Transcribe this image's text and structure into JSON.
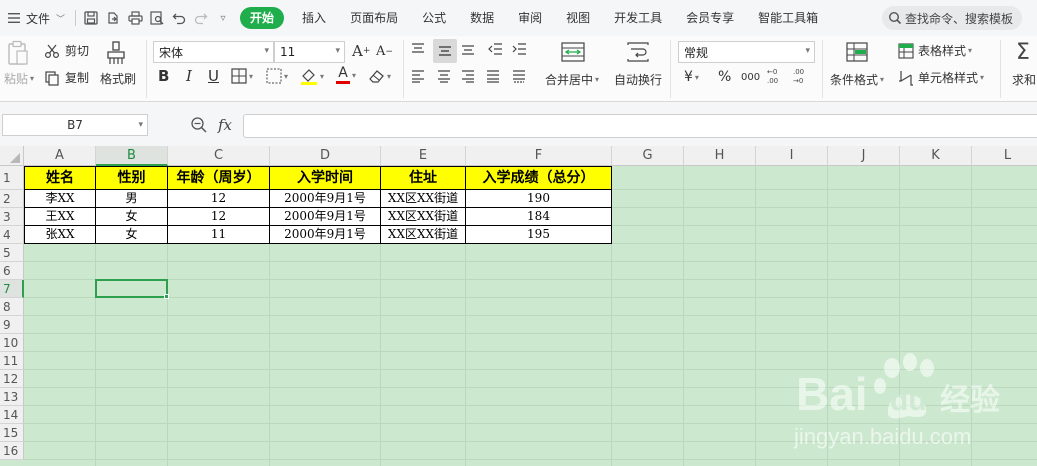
{
  "menubar": {
    "file_label": "文件",
    "tabs": [
      "开始",
      "插入",
      "页面布局",
      "公式",
      "数据",
      "审阅",
      "视图",
      "开发工具",
      "会员专享",
      "智能工具箱"
    ],
    "active_tab": "开始",
    "search_placeholder": "查找命令、搜索模板"
  },
  "ribbon": {
    "paste": "粘贴",
    "cut": "剪切",
    "copy": "复制",
    "format_painter": "格式刷",
    "font_name": "宋体",
    "font_size": "11",
    "merge_center": "合并居中",
    "wrap_text": "自动换行",
    "number_format": "常规",
    "currency_symbol": "¥",
    "percent_symbol": "%",
    "thousands_symbol": "000",
    "cond_format": "条件格式",
    "table_style": "表格样式",
    "cell_style": "单元格样式",
    "sum": "求和",
    "bold": "B",
    "italic": "I",
    "underline": "U",
    "font_color_letter": "A",
    "grow_letter": "A",
    "shrink_letter": "A"
  },
  "formula_bar": {
    "name_box": "B7",
    "fx_label": "fx",
    "content": ""
  },
  "sheet": {
    "columns": [
      "A",
      "B",
      "C",
      "D",
      "E",
      "F",
      "G",
      "H",
      "I",
      "J",
      "K",
      "L"
    ],
    "rows": [
      "1",
      "2",
      "3",
      "4",
      "5",
      "6",
      "7",
      "8",
      "9",
      "10",
      "11",
      "12",
      "13",
      "14",
      "15",
      "16"
    ],
    "selected_cell": "B7",
    "header": [
      "姓名",
      "性别",
      "年龄（周岁）",
      "入学时间",
      "住址",
      "入学成绩（总分）"
    ],
    "data": [
      [
        "李XX",
        "男",
        "12",
        "2000年9月1号",
        "XX区XX街道",
        "190"
      ],
      [
        "王XX",
        "女",
        "12",
        "2000年9月1号",
        "XX区XX街道",
        "184"
      ],
      [
        "张XX",
        "女",
        "11",
        "2000年9月1号",
        "XX区XX街道",
        "195"
      ]
    ]
  },
  "watermark": {
    "brand": "Bai",
    "brand_tail": "du",
    "cn": "经验",
    "url": "jingyan.baidu.com"
  },
  "colors": {
    "accent": "#1fae4b",
    "sheet_bg": "#cce8cf",
    "header_fill": "#ffff00",
    "selection": "#2e9e4f"
  }
}
